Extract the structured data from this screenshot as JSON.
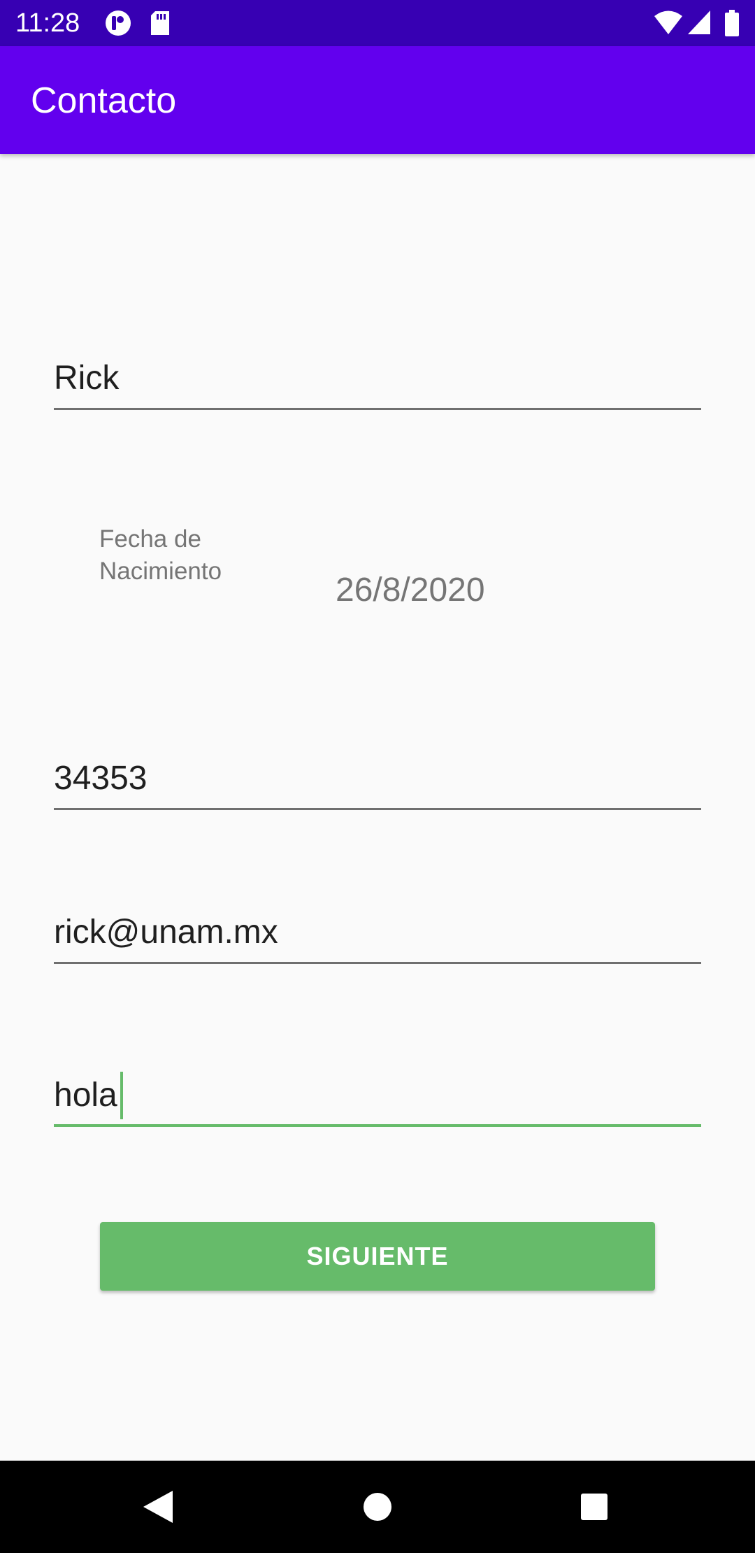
{
  "status_bar": {
    "time": "11:28",
    "icons": [
      "notification-app-icon",
      "sd-card-icon",
      "wifi-icon",
      "signal-icon",
      "battery-icon"
    ]
  },
  "app_bar": {
    "title": "Contacto",
    "color": "#6200ee"
  },
  "form": {
    "name_value": "Rick",
    "birthdate_label": "Fecha de Nacimiento",
    "birthdate_value": "26/8/2020",
    "phone_value": "34353",
    "email_value": "rick@unam.mx",
    "description_value": "hola"
  },
  "actions": {
    "next_label": "SIGUIENTE",
    "accent_color": "#66bb6a"
  },
  "nav_bar": {
    "icons": [
      "back-icon",
      "home-icon",
      "recents-icon"
    ]
  }
}
